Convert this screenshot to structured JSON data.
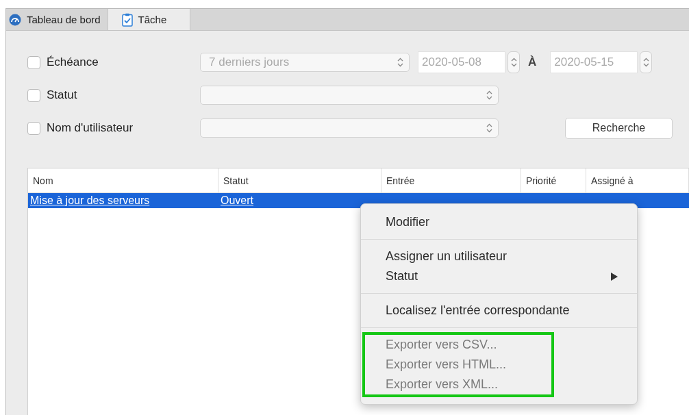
{
  "tabs": [
    {
      "label": "Tableau de bord",
      "selected": false
    },
    {
      "label": "Tâche",
      "selected": true
    }
  ],
  "filters": [
    {
      "label": "Échéance",
      "checked": false,
      "kind": "range",
      "select": "7 derniers jours",
      "from": "2020-05-08",
      "separator": "À",
      "to": "2020-05-15"
    },
    {
      "label": "Statut",
      "checked": false,
      "kind": "select"
    },
    {
      "label": "Nom d'utilisateur",
      "checked": false,
      "kind": "select"
    }
  ],
  "search_button": "Recherche",
  "table": {
    "columns": [
      "Nom",
      "Statut",
      "Entrée",
      "Priorité",
      "Assigné à"
    ],
    "rows": [
      {
        "selected": true,
        "cells": [
          "Mise à jour des serveurs",
          "Ouvert"
        ]
      }
    ]
  },
  "context_menu": {
    "groups": [
      {
        "highlighted": false,
        "items": [
          {
            "label": "Modifier",
            "disabled": false,
            "submenu": false
          }
        ]
      },
      {
        "highlighted": false,
        "items": [
          {
            "label": "Assigner un utilisateur",
            "disabled": false,
            "submenu": false
          },
          {
            "label": "Statut",
            "disabled": false,
            "submenu": true
          }
        ]
      },
      {
        "highlighted": false,
        "items": [
          {
            "label": "Localisez l'entrée correspondante",
            "disabled": false,
            "submenu": false
          }
        ]
      },
      {
        "highlighted": true,
        "items": [
          {
            "label": "Exporter vers CSV...",
            "disabled": true,
            "submenu": false
          },
          {
            "label": "Exporter vers HTML...",
            "disabled": true,
            "submenu": false
          },
          {
            "label": "Exporter vers XML...",
            "disabled": true,
            "submenu": false
          }
        ]
      }
    ]
  }
}
